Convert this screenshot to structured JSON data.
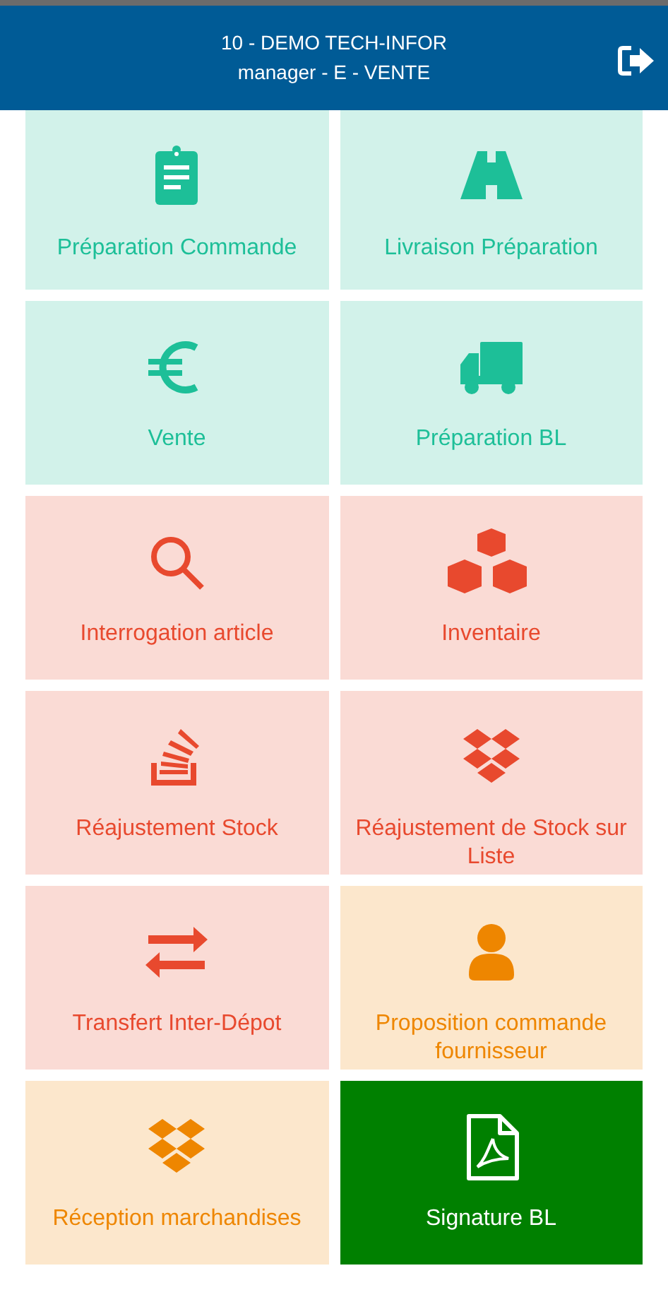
{
  "header": {
    "title": "10 - DEMO TECH-INFOR",
    "subtitle": "manager - E - VENTE"
  },
  "tiles": [
    {
      "label": "Préparation Commande",
      "color": "#1dbf98",
      "filled": false
    },
    {
      "label": "Livraison Préparation",
      "color": "#1dbf98",
      "filled": false
    },
    {
      "label": "Vente",
      "color": "#1dbf98",
      "filled": false
    },
    {
      "label": "Préparation BL",
      "color": "#1dbf98",
      "filled": false
    },
    {
      "label": "Interrogation article",
      "color": "#e8492e",
      "filled": false
    },
    {
      "label": "Inventaire",
      "color": "#e8492e",
      "filled": false
    },
    {
      "label": "Réajustement Stock",
      "color": "#e8492e",
      "filled": false
    },
    {
      "label": "Réajustement de Stock sur Liste",
      "color": "#e8492e",
      "filled": false
    },
    {
      "label": "Transfert Inter-Dépot",
      "color": "#e8492e",
      "filled": false
    },
    {
      "label": "Proposition commande fournisseur",
      "color": "#ee8600",
      "filled": false
    },
    {
      "label": "Réception marchandises",
      "color": "#ee8600",
      "filled": false
    },
    {
      "label": "Signature BL",
      "color": "#008000",
      "filled": true
    }
  ]
}
